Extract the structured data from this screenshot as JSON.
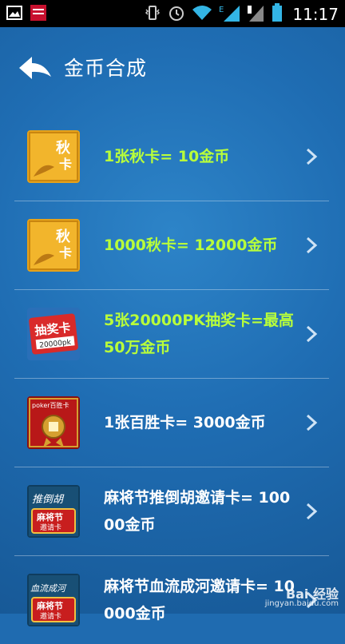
{
  "status_bar": {
    "time": "11:17",
    "network": "E"
  },
  "header": {
    "title": "金币合成"
  },
  "items": [
    {
      "text": "1张秋卡= 10金币",
      "text_color": "#b9ff3a",
      "icon": "autumn-card-icon",
      "card_label": "秋\n卡"
    },
    {
      "text": "1000秋卡= 12000金币",
      "text_color": "#b9ff3a",
      "icon": "autumn-card-icon",
      "card_label": "秋\n卡"
    },
    {
      "text": "5张20000PK抽奖卡=最高50万金币",
      "text_color": "#b9ff3a",
      "icon": "lottery-card-icon",
      "card_label": "抽奖卡",
      "card_sub": "20000pk"
    },
    {
      "text": "1张百胜卡= 3000金币",
      "text_color": "#ffffff",
      "icon": "poker-card-icon",
      "card_label": "poker百胜卡"
    },
    {
      "text": "麻将节推倒胡邀请卡= 10000金币",
      "text_color": "#ffffff",
      "icon": "mahjong-invite-card-icon",
      "card_label": "推倒胡",
      "card_sub": "麻将节",
      "card_sub2": "邀请卡"
    },
    {
      "text": "麻将节血流成河邀请卡= 10000金币",
      "text_color": "#ffffff",
      "icon": "mahjong-invite-card-icon",
      "card_label": "血流成河",
      "card_sub": "麻将节",
      "card_sub2": "邀请卡"
    }
  ],
  "watermark": {
    "brand": "Bai 经验",
    "url": "jingyan.baidu.com"
  },
  "colors": {
    "background": "#1f6db3",
    "highlight_text": "#b9ff3a",
    "normal_text": "#ffffff"
  }
}
